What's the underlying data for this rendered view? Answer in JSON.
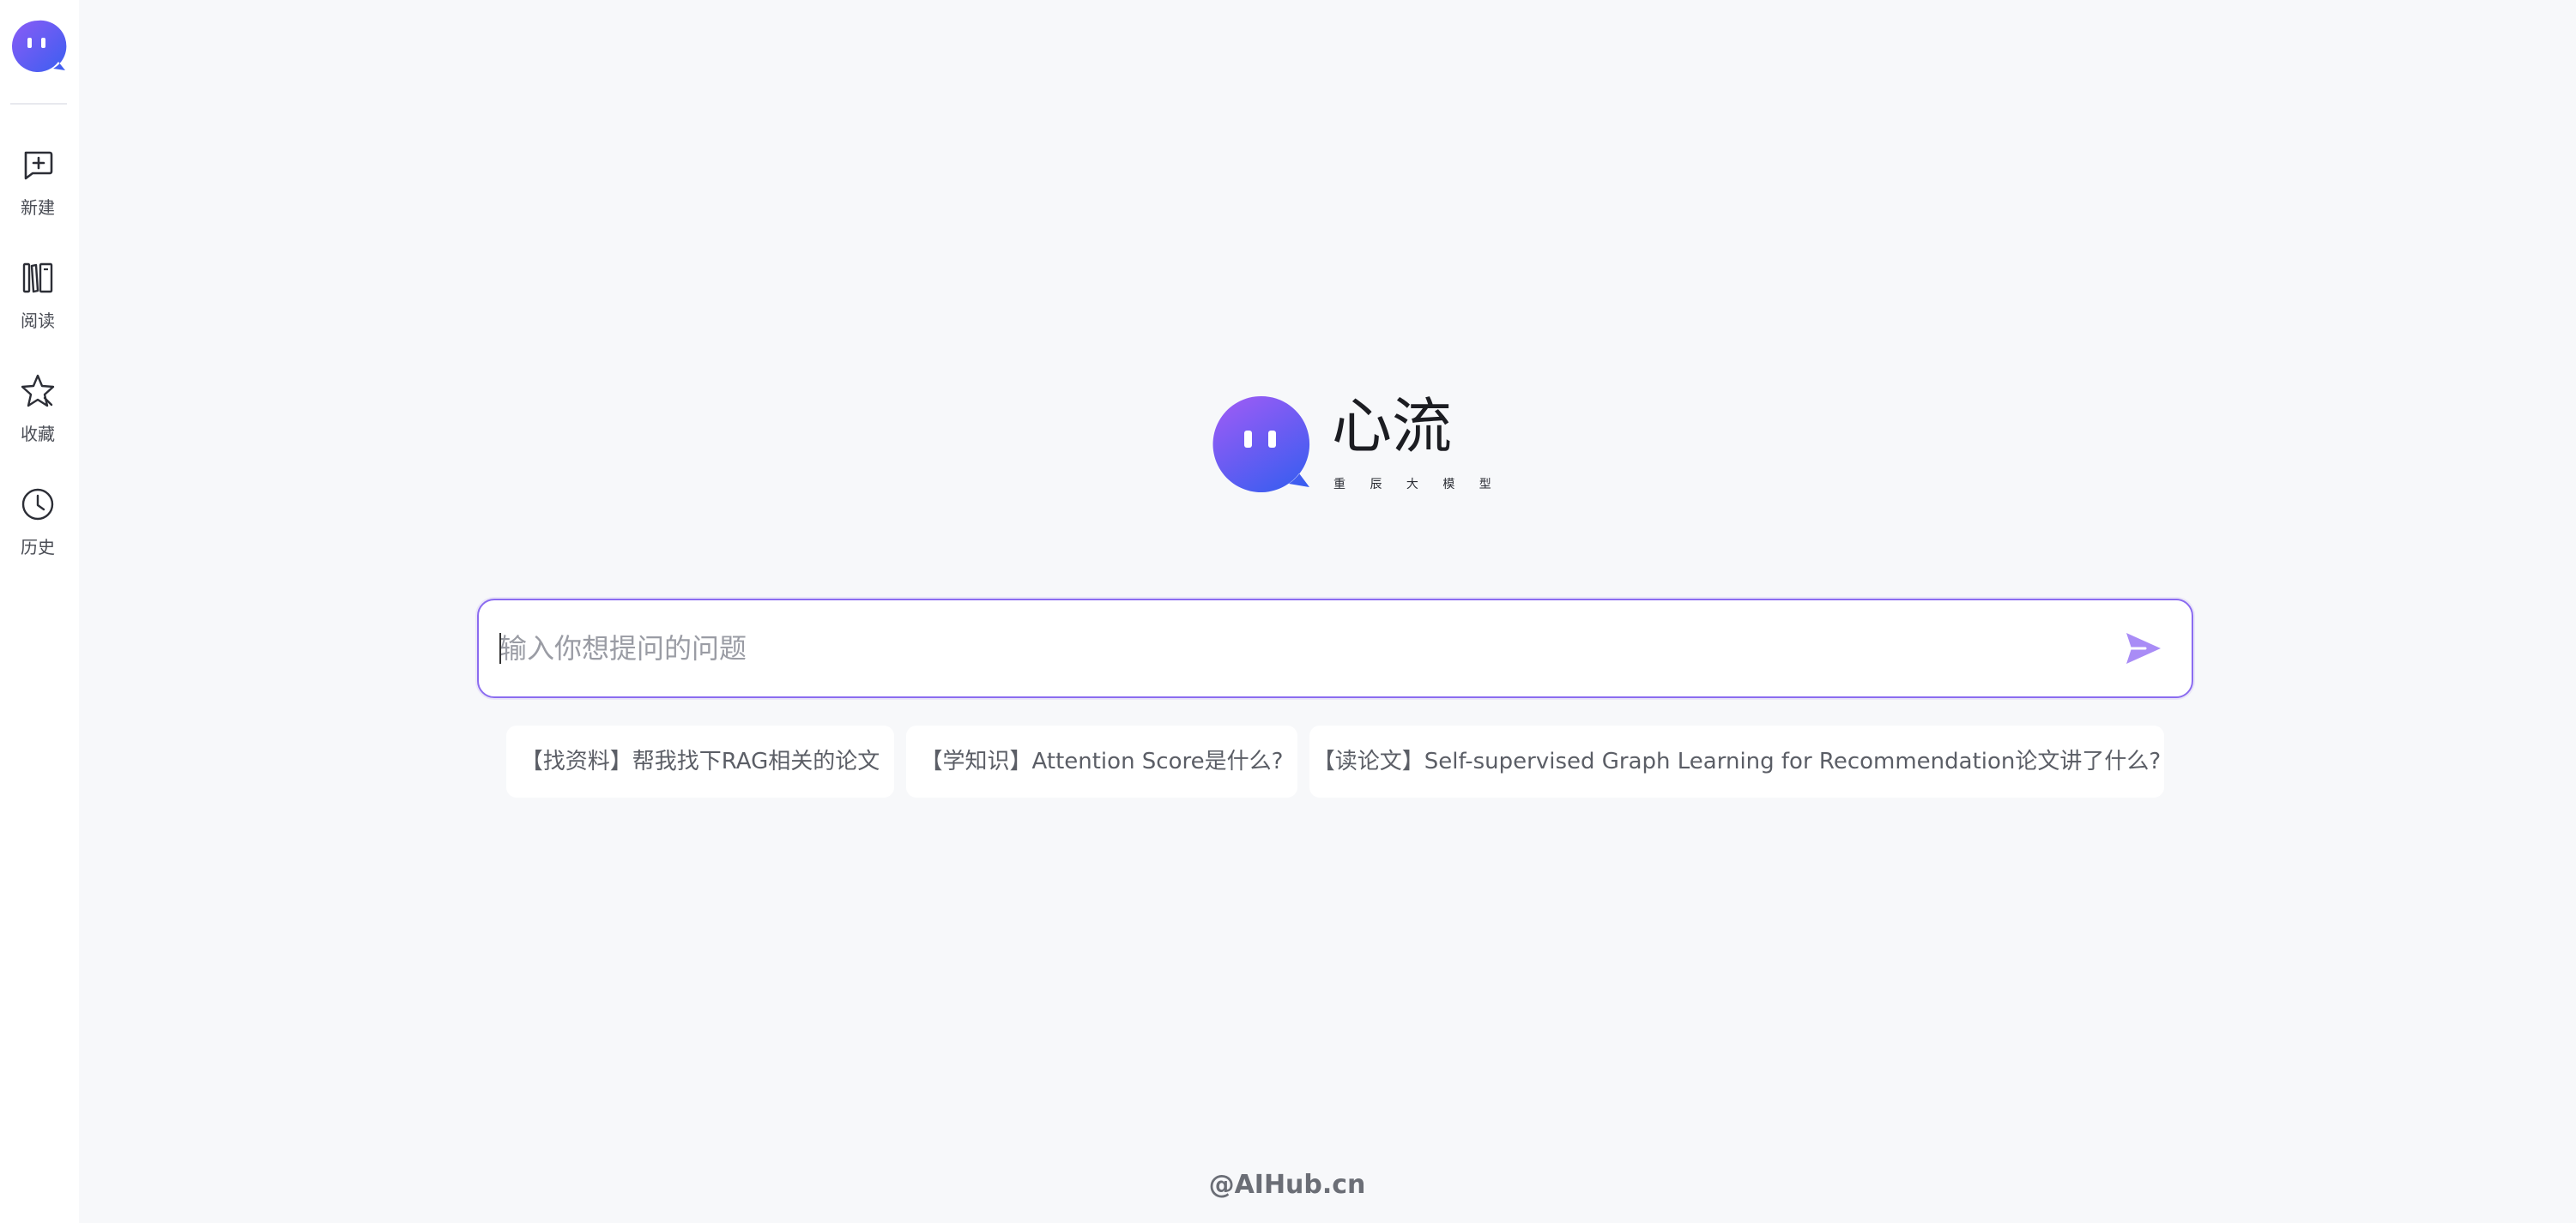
{
  "sidebar": {
    "logo": "xinliu-logo",
    "items": [
      {
        "label": "新建",
        "icon": "new-chat-icon"
      },
      {
        "label": "阅读",
        "icon": "library-icon"
      },
      {
        "label": "收藏",
        "icon": "star-icon"
      },
      {
        "label": "历史",
        "icon": "clock-icon"
      }
    ]
  },
  "brand": {
    "name": "心流",
    "subtitle": "重 辰 大 模 型"
  },
  "search": {
    "placeholder": "输入你想提问的问题",
    "value": ""
  },
  "suggestions": [
    "【找资料】帮我找下RAG相关的论文",
    "【学知识】Attention Score是什么?",
    "【读论文】Self-supervised Graph Learning for Recommendation论文讲了什么?"
  ],
  "footer": {
    "watermark": "@AIHub.cn"
  },
  "colors": {
    "accent": "#7b5cf0",
    "accent_light": "#a98cf6",
    "logo_blue": "#4a5cf0",
    "background": "#f7f8fa"
  }
}
